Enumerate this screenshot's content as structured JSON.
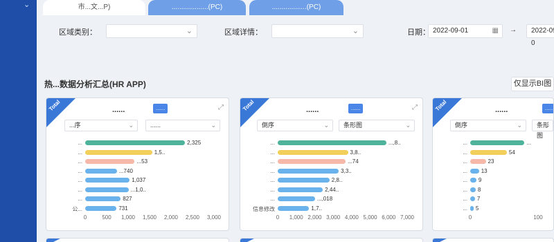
{
  "rail": {
    "chevron": "⌄"
  },
  "tabs": [
    {
      "label": "市...文...P)"
    },
    {
      "label": "...................(PC)"
    },
    {
      "label": "..................(PC)"
    }
  ],
  "filters": {
    "region_type_label": "区域类别：",
    "region_detail_label": "区域详情：",
    "date_label": "日期：",
    "date_start": "2022-09-01",
    "date_sep": "→",
    "date_end": "2022-09-0"
  },
  "section": {
    "title": "热...数据分析汇总(HR APP)",
    "bi_button": "仅显示BI图"
  },
  "cards": [
    {
      "corner": "Total",
      "title": "......",
      "badge": "......",
      "select1": "...序",
      "select2": "......",
      "max": 3000,
      "ticks": [
        "0",
        "500",
        "1,000",
        "1,500",
        "2,000",
        "2,500",
        "3,000"
      ],
      "bars": [
        {
          "label": "...",
          "value": 2325,
          "display": "2,325",
          "color": "#4fb39c"
        },
        {
          "label": "...",
          "value": 1560,
          "display": "1,5..",
          "color": "#f2cf5b"
        },
        {
          "label": "...",
          "value": 1153,
          "display": "...53",
          "color": "#f6b8a8"
        },
        {
          "label": "...",
          "value": 740,
          "display": "...740",
          "color": "#69b2ec"
        },
        {
          "label": "...",
          "value": 1037,
          "display": "1,037",
          "color": "#69b2ec"
        },
        {
          "label": "...",
          "value": 1010,
          "display": "...1,0..",
          "color": "#69b2ec"
        },
        {
          "label": "...",
          "value": 827,
          "display": "827",
          "color": "#69b2ec"
        },
        {
          "label": "公...",
          "value": 731,
          "display": "731",
          "color": "#69b2ec"
        }
      ]
    },
    {
      "corner": "Total",
      "title": "......",
      "badge": "......",
      "select1": "倒序",
      "select2": "条形图",
      "max": 7000,
      "ticks": [
        "0",
        "1,000",
        "2,000",
        "3,000",
        "4,000",
        "5,000",
        "6,000",
        "7,000"
      ],
      "bars": [
        {
          "label": "...",
          "value": 5870,
          "display": "...,8..",
          "color": "#4fb39c"
        },
        {
          "label": "...",
          "value": 3800,
          "display": "3,8..",
          "color": "#f2cf5b"
        },
        {
          "label": "...",
          "value": 3674,
          "display": "...74",
          "color": "#f6b8a8"
        },
        {
          "label": "...",
          "value": 3300,
          "display": "3,3..",
          "color": "#69b2ec"
        },
        {
          "label": "...",
          "value": 2800,
          "display": "2,8..",
          "color": "#69b2ec"
        },
        {
          "label": "...",
          "value": 2440,
          "display": "2,44..",
          "color": "#69b2ec"
        },
        {
          "label": "...",
          "value": 2018,
          "display": "...,018",
          "color": "#69b2ec"
        },
        {
          "label": "信息修改",
          "value": 1700,
          "display": "1,7..",
          "color": "#69b2ec"
        }
      ]
    },
    {
      "corner": "Total",
      "title": "......",
      "badge": "......",
      "select1": "倒序",
      "select2": "条形图",
      "max": 100,
      "ticks": [
        "0",
        "100"
      ],
      "bars": [
        {
          "label": "...",
          "value": 80,
          "display": "...",
          "color": "#4fb39c"
        },
        {
          "label": "...",
          "value": 54,
          "display": "54",
          "color": "#f2cf5b"
        },
        {
          "label": "...",
          "value": 23,
          "display": "23",
          "color": "#f6b8a8"
        },
        {
          "label": "...",
          "value": 13,
          "display": "13",
          "color": "#69b2ec"
        },
        {
          "label": "...",
          "value": 9,
          "display": "9",
          "color": "#69b2ec"
        },
        {
          "label": "...",
          "value": 8,
          "display": "8",
          "color": "#69b2ec"
        },
        {
          "label": "...",
          "value": 7,
          "display": "7",
          "color": "#69b2ec"
        },
        {
          "label": "...",
          "value": 5,
          "display": "5",
          "color": "#69b2ec"
        }
      ]
    }
  ],
  "chart_data": [
    {
      "type": "bar",
      "title": "",
      "categories": [
        "...",
        "...",
        "...",
        "...",
        "...",
        "...",
        "...",
        "公..."
      ],
      "values": [
        2325,
        1560,
        1153,
        740,
        1037,
        1010,
        827,
        731
      ],
      "xlim": [
        0,
        3000
      ]
    },
    {
      "type": "bar",
      "title": "",
      "categories": [
        "...",
        "...",
        "...",
        "...",
        "...",
        "...",
        "...",
        "信息修改"
      ],
      "values": [
        5870,
        3800,
        3674,
        3300,
        2800,
        2440,
        2018,
        1700
      ],
      "xlim": [
        0,
        7000
      ]
    },
    {
      "type": "bar",
      "title": "",
      "categories": [
        "...",
        "...",
        "...",
        "...",
        "...",
        "...",
        "...",
        "..."
      ],
      "values": [
        80,
        54,
        23,
        13,
        9,
        8,
        7,
        5
      ],
      "xlim": [
        0,
        100
      ]
    }
  ]
}
